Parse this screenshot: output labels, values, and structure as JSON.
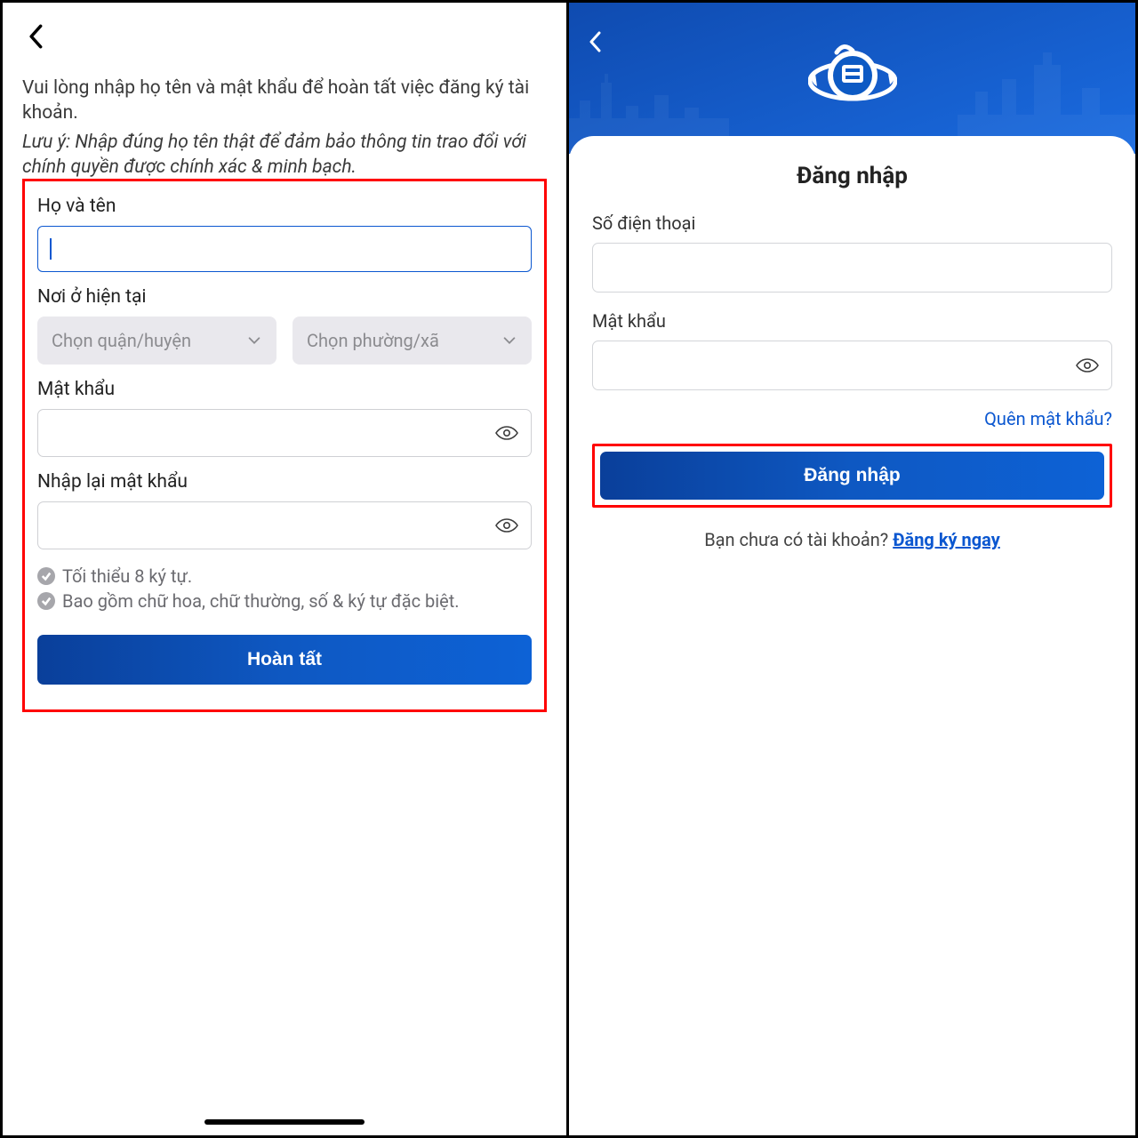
{
  "left": {
    "intro_text": "Vui lòng nhập họ tên và mật khẩu để hoàn tất việc đăng ký tài khoản.",
    "note_text": "Lưu ý: Nhập đúng họ tên thật để đảm bảo thông tin trao đổi với chính quyền được chính xác & minh bạch.",
    "labels": {
      "fullname": "Họ và tên",
      "residence": "Nơi ở hiện tại",
      "password": "Mật khẩu",
      "password_confirm": "Nhập lại mật khẩu"
    },
    "placeholders": {
      "district": "Chọn quận/huyện",
      "ward": "Chọn phường/xã"
    },
    "rules": {
      "r1": "Tối thiểu 8 ký tự.",
      "r2": "Bao gồm chữ hoa, chữ thường, số & ký tự đặc biệt."
    },
    "submit": "Hoàn tất"
  },
  "right": {
    "title": "Đăng nhập",
    "labels": {
      "phone": "Số điện thoại",
      "password": "Mật khẩu"
    },
    "forgot": "Quên mật khẩu?",
    "login_btn": "Đăng nhập",
    "no_account": "Bạn chưa có tài khoản? ",
    "register": "Đăng ký ngay"
  }
}
